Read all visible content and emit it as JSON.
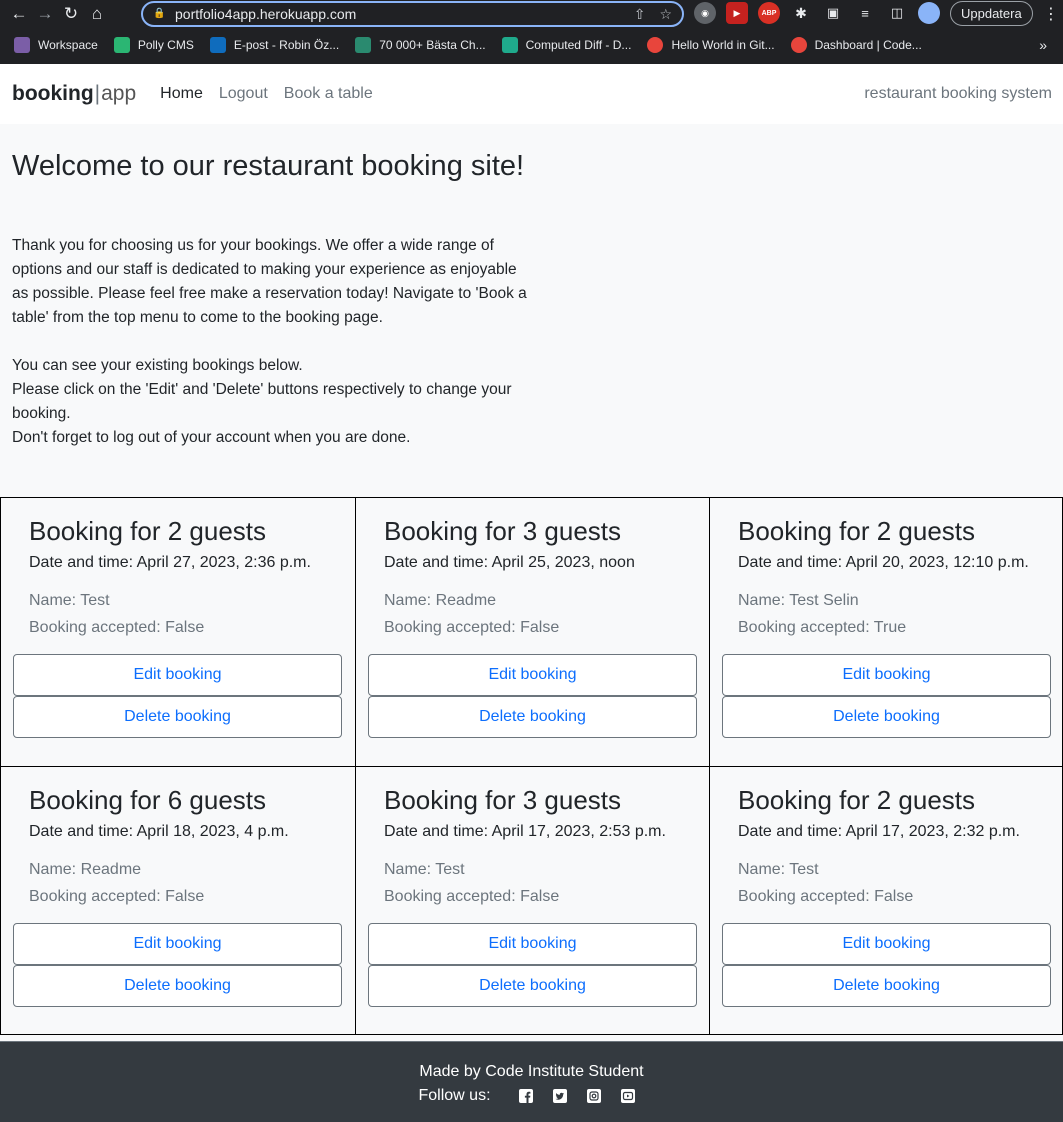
{
  "browser": {
    "url": "portfolio4app.herokuapp.com",
    "update_label": "Uppdatera",
    "bookmarks": [
      {
        "label": "Workspace",
        "color": "#7b5ea7"
      },
      {
        "label": "Polly CMS",
        "color": "#2bb673"
      },
      {
        "label": "E-post - Robin Öz...",
        "color": "#0f6cbd"
      },
      {
        "label": "70 000+ Bästa Ch...",
        "color": "#2a8a6f"
      },
      {
        "label": "Computed Diff - D...",
        "color": "#1faa8c"
      },
      {
        "label": "Hello World in Git...",
        "color": "#e8453c"
      },
      {
        "label": "Dashboard | Code...",
        "color": "#e8453c"
      }
    ]
  },
  "navbar": {
    "brand_bold": "booking",
    "brand_sep": "|",
    "brand_light": "app",
    "links": [
      {
        "label": "Home",
        "active": true
      },
      {
        "label": "Logout",
        "active": false
      },
      {
        "label": "Book a table",
        "active": false
      }
    ],
    "tagline": "restaurant booking system"
  },
  "main": {
    "title": "Welcome to our restaurant booking site!",
    "intro_p1": "Thank you for choosing us for your bookings. We offer a wide range of options and our staff is dedicated to making your experience as enjoyable as possible. Please feel free make a reservation today! Navigate to 'Book a table' from the top menu to come to the booking page.",
    "intro_p2_l1": "You can see your existing bookings below.",
    "intro_p2_l2": "Please click on the 'Edit' and 'Delete' buttons respectively to change your booking.",
    "intro_p2_l3": "Don't forget to log out of your account when you are done."
  },
  "bookings": [
    {
      "title": "Booking for 2 guests",
      "datetime": "Date and time: April 27, 2023, 2:36 p.m.",
      "name": "Name: Test",
      "accepted": "Booking accepted: False"
    },
    {
      "title": "Booking for 3 guests",
      "datetime": "Date and time: April 25, 2023, noon",
      "name": "Name: Readme",
      "accepted": "Booking accepted: False"
    },
    {
      "title": "Booking for 2 guests",
      "datetime": "Date and time: April 20, 2023, 12:10 p.m.",
      "name": "Name: Test Selin",
      "accepted": "Booking accepted: True"
    },
    {
      "title": "Booking for 6 guests",
      "datetime": "Date and time: April 18, 2023, 4 p.m.",
      "name": "Name: Readme",
      "accepted": "Booking accepted: False"
    },
    {
      "title": "Booking for 3 guests",
      "datetime": "Date and time: April 17, 2023, 2:53 p.m.",
      "name": "Name: Test",
      "accepted": "Booking accepted: False"
    },
    {
      "title": "Booking for 2 guests",
      "datetime": "Date and time: April 17, 2023, 2:32 p.m.",
      "name": "Name: Test",
      "accepted": "Booking accepted: False"
    }
  ],
  "buttons": {
    "edit": "Edit booking",
    "delete": "Delete booking"
  },
  "footer": {
    "made_by": "Made by Code Institute Student",
    "follow": "Follow us:",
    "socials": [
      "facebook-icon",
      "twitter-icon",
      "instagram-icon",
      "youtube-icon"
    ]
  }
}
